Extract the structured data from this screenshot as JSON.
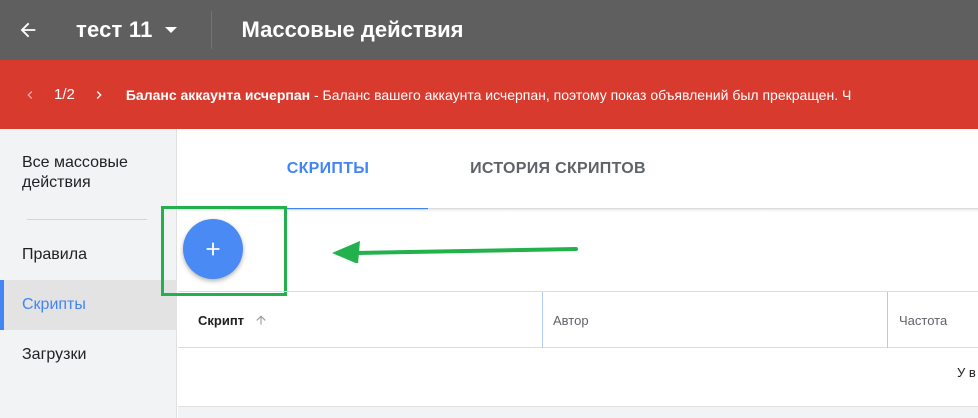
{
  "header": {
    "back_icon": "arrow-left-icon",
    "account_name": "тест 11",
    "dropdown_icon": "caret-down-icon",
    "page_title": "Массовые действия"
  },
  "banner": {
    "prev_icon": "chevron-left-icon",
    "counter": "1/2",
    "next_icon": "chevron-right-icon",
    "title": "Баланс аккаунта исчерпан",
    "message": " - Баланс вашего аккаунта исчерпан, поэтому показ объявлений был прекращен. Ч",
    "color": "#d93a2e"
  },
  "sidebar": {
    "all_actions": "Все массовые действия",
    "items": [
      {
        "label": "Правила"
      },
      {
        "label": "Скрипты"
      },
      {
        "label": "Загрузки"
      }
    ]
  },
  "tabs": [
    {
      "label": "СКРИПТЫ"
    },
    {
      "label": "ИСТОРИЯ СКРИПТОВ"
    }
  ],
  "fab": {
    "icon": "plus-icon"
  },
  "annotation": {
    "color": "#22b14c"
  },
  "table": {
    "headers": [
      "Скрипт",
      "Автор",
      "Частота"
    ],
    "sort_icon": "arrow-up-icon",
    "row_text": "У в"
  },
  "accent_color": "#4285f4"
}
